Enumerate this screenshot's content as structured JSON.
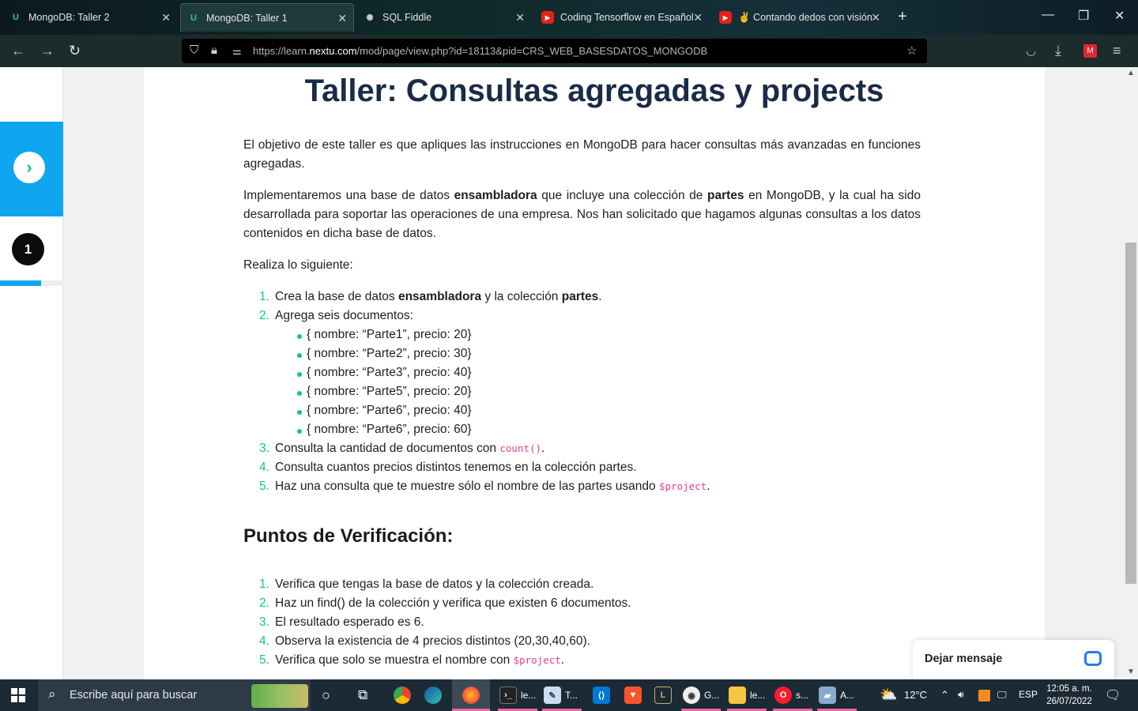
{
  "browser": {
    "tabs": [
      {
        "title": "MongoDB: Taller 2",
        "icon": "nextu-icon",
        "active": false
      },
      {
        "title": "MongoDB: Taller 1",
        "icon": "nextu-icon",
        "active": true
      },
      {
        "title": "SQL Fiddle",
        "icon": "sqlfiddle-icon",
        "active": false
      },
      {
        "title": "Coding Tensorflow en Español",
        "icon": "youtube-icon",
        "active": false
      },
      {
        "title": "✌ Contando dedos con visión",
        "icon": "youtube-icon",
        "active": false
      }
    ],
    "url_prefix": "https://learn.",
    "url_domain": "nextu.com",
    "url_path": "/mod/page/view.php?id=18113&pid=CRS_WEB_BASESDATOS_MONGODB"
  },
  "sidebar": {
    "step_number": "1",
    "progress_fraction": 0.65
  },
  "page": {
    "title": "Taller: Consultas agregadas y projects",
    "intro": "El objetivo de este taller es que apliques las instrucciones en MongoDB para hacer consultas más avanzadas en funciones agregadas.",
    "p2_a": "Implementaremos una base de datos ",
    "p2_b": "ensambladora",
    "p2_c": " que incluye una colección de ",
    "p2_d": "partes",
    "p2_e": " en MongoDB, y la cual ha sido desarrollada para soportar las operaciones de una empresa. Nos han solicitado que hagamos algunas consultas a los datos contenidos en dicha base de datos.",
    "realiza": "Realiza lo siguiente:",
    "steps": {
      "s1_a": "Crea la base de datos ",
      "s1_b": "ensambladora",
      "s1_c": " y la colección ",
      "s1_d": "partes",
      "s1_e": ".",
      "s2": "Agrega seis documentos:",
      "docs": [
        "{ nombre: “Parte1”, precio: 20}",
        "{ nombre: “Parte2”, precio: 30}",
        "{ nombre: “Parte3”, precio: 40}",
        "{ nombre: “Parte5”, precio: 20}",
        "{ nombre: “Parte6”, precio: 40}",
        "{ nombre: “Parte6”, precio: 60}"
      ],
      "s3_a": "Consulta la cantidad de documentos con ",
      "s3_code": "count()",
      "s3_b": ".",
      "s4": "Consulta cuantos precios distintos tenemos en la colección partes.",
      "s5_a": "Haz una consulta que te muestre sólo el nombre de las partes usando ",
      "s5_code": "$project",
      "s5_b": "."
    },
    "verif_heading": "Puntos de Verificación:",
    "verif": {
      "v1": "Verifica que tengas la base de datos y la colección creada.",
      "v2": "Haz un find() de la colección y  verifica que existen 6 documentos.",
      "v3": "El resultado esperado es 6.",
      "v4": "Observa la existencia de 4 precios distintos (20,30,40,60).",
      "v5_a": "Verifica que solo se muestra el nombre con ",
      "v5_code": "$project",
      "v5_b": "."
    }
  },
  "chat": {
    "label": "Dejar mensaje"
  },
  "taskbar": {
    "search_placeholder": "Escribe aquí para buscar",
    "apps": [
      {
        "label": "le...",
        "icon": "terminal-icon"
      },
      {
        "label": "T...",
        "icon": "paint-icon"
      },
      {
        "label": "G...",
        "icon": "app-icon"
      },
      {
        "label": "le...",
        "icon": "folder-icon"
      },
      {
        "label": "s...",
        "icon": "opera-icon"
      },
      {
        "label": "A...",
        "icon": "app-icon"
      }
    ],
    "temperature": "12°C",
    "language": "ESP",
    "time": "12:05 a. m.",
    "date": "26/07/2022"
  },
  "colors": {
    "accent_blue": "#10a6ef",
    "accent_green": "#10c87a",
    "title_navy": "#1a2b48",
    "code_pink": "#e83e8c"
  }
}
